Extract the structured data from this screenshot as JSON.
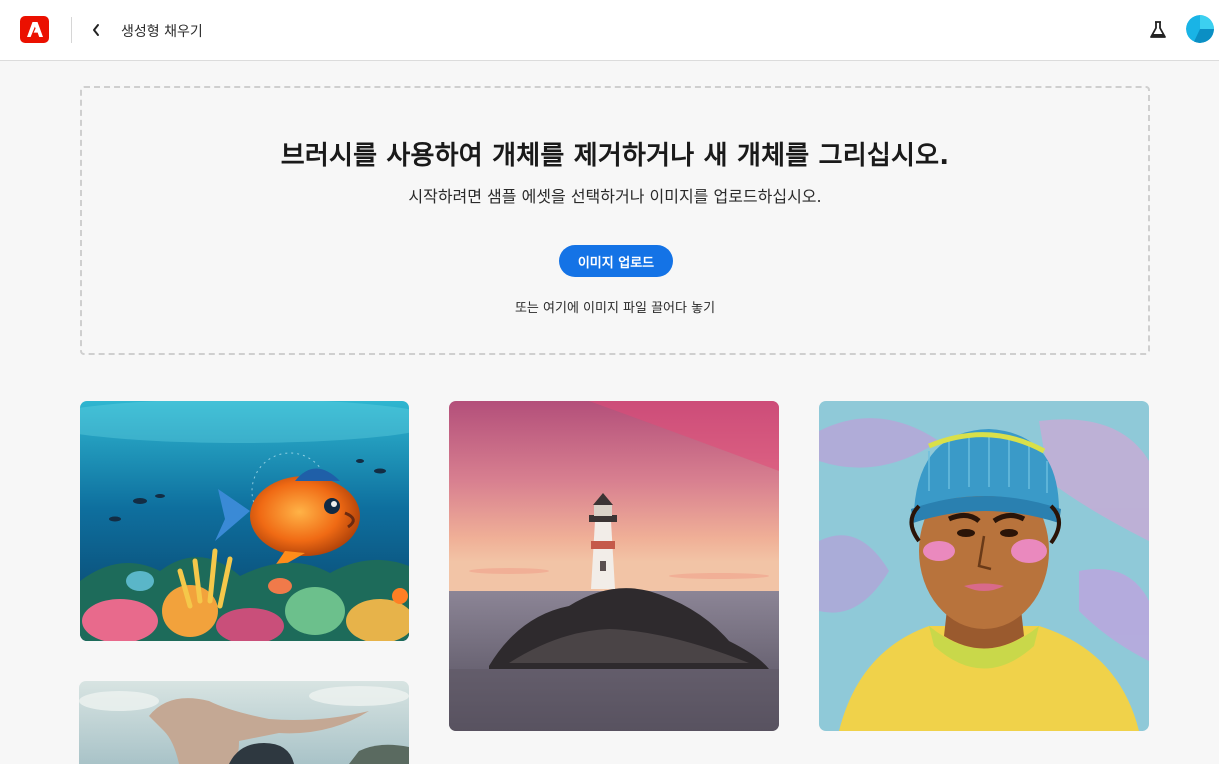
{
  "header": {
    "logo_icon": "adobe-logo-icon",
    "back_icon": "chevron-left-icon",
    "title": "생성형 채우기",
    "lab_icon": "flask-icon",
    "avatar_icon": "user-avatar"
  },
  "dropzone": {
    "headline": "브러시를 사용하여 개체를 제거하거나 새 개체를 그리십시오.",
    "subline": "시작하려면 샘플 에셋을 선택하거나 이미지를 업로드하십시오.",
    "upload_label": "이미지 업로드",
    "drop_hint": "또는 여기에 이미지 파일 끌어다 놓기"
  },
  "samples": [
    {
      "name": "underwater-fish"
    },
    {
      "name": "lighthouse-sunset"
    },
    {
      "name": "portrait-beanie"
    },
    {
      "name": "architecture-building"
    }
  ],
  "colors": {
    "accent": "#1473e6",
    "logo": "#eb1000"
  }
}
